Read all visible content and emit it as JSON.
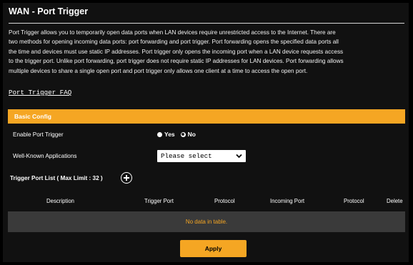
{
  "page": {
    "title": "WAN - Port Trigger",
    "description_lines": [
      "Port Trigger allows you to temporarily open data ports when LAN devices require unrestricted access to the Internet. There are",
      "two methods for opening incoming data ports: port forwarding and port trigger. Port forwarding opens the specified data ports all",
      "the time and devices must use static IP addresses. Port trigger only opens the incoming port when a LAN device requests access",
      "to the trigger port. Unlike port forwarding, port trigger does not require static IP addresses for LAN devices. Port forwarding allows",
      "multiple devices to share a single open port and port trigger only allows one client at a time to access the open port."
    ],
    "faq_link": "Port Trigger FAQ"
  },
  "basic_config": {
    "section_title": "Basic Config",
    "enable_label": "Enable Port Trigger",
    "yes_label": "Yes",
    "no_label": "No",
    "selected": "No",
    "apps_label": "Well-Known Applications",
    "apps_value": "Please select"
  },
  "trigger_list": {
    "title": "Trigger Port List ( Max Limit : 32 )",
    "columns": [
      "Description",
      "Trigger Port",
      "Protocol",
      "Incoming Port",
      "Protocol",
      "Delete"
    ],
    "empty_text": "No data in table."
  },
  "apply_label": "Apply",
  "colors": {
    "accent": "#f5a623",
    "background": "#111111",
    "row_background": "#3a3a3a"
  },
  "icons": {
    "add": "plus-circle-icon",
    "dropdown": "chevron-down-icon"
  }
}
